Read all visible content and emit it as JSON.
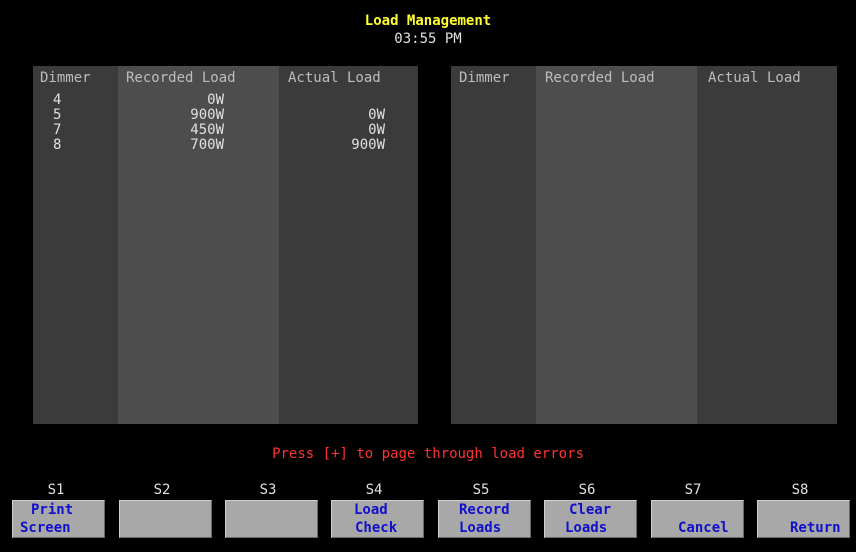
{
  "header": {
    "title": "Load Management",
    "time": "03:55 PM"
  },
  "left_table": {
    "columns": [
      "Dimmer",
      "Recorded Load",
      "Actual Load"
    ],
    "rows": [
      {
        "dimmer": "4",
        "recorded": "0W",
        "actual": ""
      },
      {
        "dimmer": "5",
        "recorded": "900W",
        "actual": "0W"
      },
      {
        "dimmer": "7",
        "recorded": "450W",
        "actual": "0W"
      },
      {
        "dimmer": "8",
        "recorded": "700W",
        "actual": "900W"
      }
    ]
  },
  "right_table": {
    "columns": [
      "Dimmer",
      "Recorded Load",
      "Actual Load"
    ],
    "rows": []
  },
  "prompt": "Press [+] to page through load errors",
  "softkeys": [
    {
      "key": "S1",
      "line1": "Print",
      "line2": "Screen"
    },
    {
      "key": "S2",
      "line1": "",
      "line2": ""
    },
    {
      "key": "S3",
      "line1": "",
      "line2": ""
    },
    {
      "key": "S4",
      "line1": "Load",
      "line2": "Check"
    },
    {
      "key": "S5",
      "line1": "Record",
      "line2": "Loads"
    },
    {
      "key": "S6",
      "line1": "Clear",
      "line2": "Loads"
    },
    {
      "key": "S7",
      "line1": "",
      "line2": "Cancel"
    },
    {
      "key": "S8",
      "line1": "",
      "line2": "Return"
    }
  ],
  "colors": {
    "background": "#000000",
    "title": "#ffff33",
    "prompt": "#ff3333",
    "softkey_text": "#1010cc",
    "softkey_face": "#a8a8a8"
  }
}
